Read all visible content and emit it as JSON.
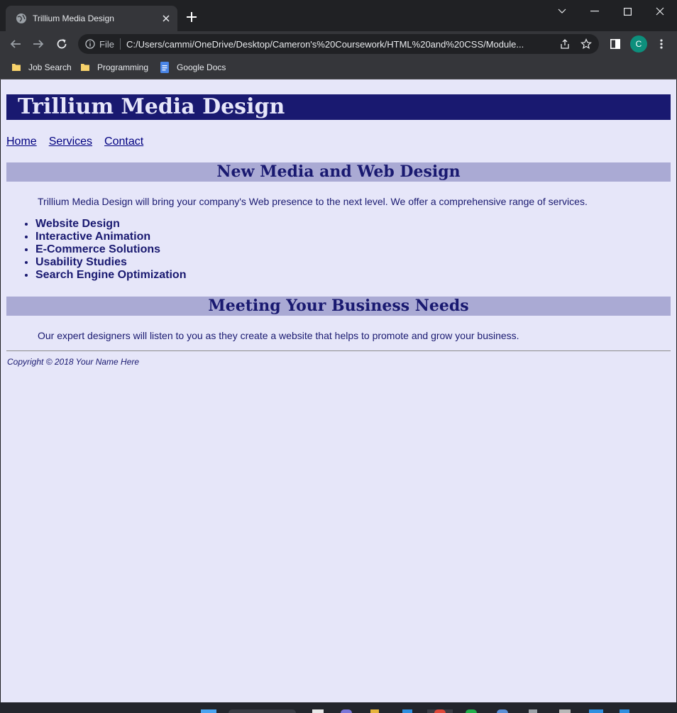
{
  "browser": {
    "tab_title": "Trillium Media Design",
    "scheme_label": "File",
    "url": "C:/Users/cammi/OneDrive/Desktop/Cameron's%20Coursework/HTML%20and%20CSS/Module...",
    "profile_initial": "C",
    "bookmarks": [
      {
        "label": "Job Search",
        "icon": "folder-icon"
      },
      {
        "label": "Programming",
        "icon": "folder-icon"
      },
      {
        "label": "Google Docs",
        "icon": "google-docs-icon"
      }
    ],
    "colors": {
      "frame": "#202124",
      "toolbar": "#35363a",
      "profile": "#0d8f7c"
    }
  },
  "page": {
    "site_title": "Trillium Media Design",
    "nav": [
      "Home",
      "Services",
      "Contact"
    ],
    "section1_heading": "New Media and Web Design",
    "section1_text": "Trillium Media Design will bring your company's Web presence to the next level. We offer a comprehensive range of services.",
    "services": [
      "Website Design",
      "Interactive Animation",
      "E-Commerce Solutions",
      "Usability Studies",
      "Search Engine Optimization"
    ],
    "section2_heading": "Meeting Your Business Needs",
    "section2_text": "Our expert designers will listen to you as they create a website that helps to promote and grow your business.",
    "copyright": "Copyright © 2018 Your Name Here",
    "colors": {
      "background": "#e6e6fa",
      "header": "#191970",
      "heading_band": "#aaaad4",
      "link": "#000080"
    }
  }
}
